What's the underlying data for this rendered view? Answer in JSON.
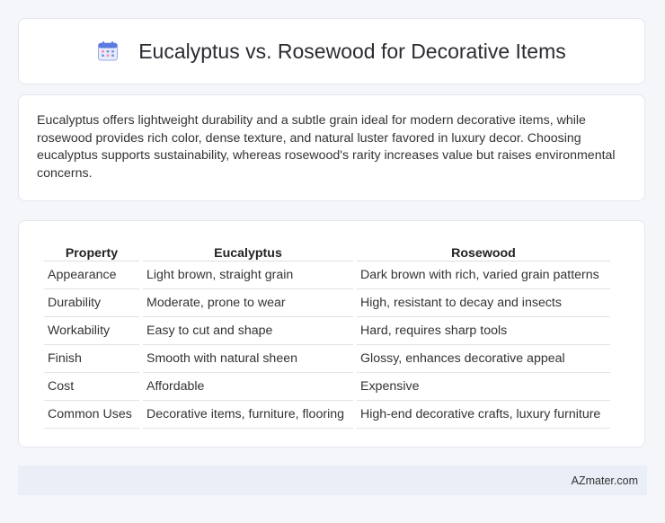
{
  "header": {
    "title": "Eucalyptus vs. Rosewood for Decorative Items",
    "icon": "calendar-icon"
  },
  "summary": {
    "text": "Eucalyptus offers lightweight durability and a subtle grain ideal for modern decorative items, while rosewood provides rich color, dense texture, and natural luster favored in luxury decor. Choosing eucalyptus supports sustainability, whereas rosewood's rarity increases value but raises environmental concerns."
  },
  "table": {
    "headers": [
      "Property",
      "Eucalyptus",
      "Rosewood"
    ],
    "rows": [
      [
        "Appearance",
        "Light brown, straight grain",
        "Dark brown with rich, varied grain patterns"
      ],
      [
        "Durability",
        "Moderate, prone to wear",
        "High, resistant to decay and insects"
      ],
      [
        "Workability",
        "Easy to cut and shape",
        "Hard, requires sharp tools"
      ],
      [
        "Finish",
        "Smooth with natural sheen",
        "Glossy, enhances decorative appeal"
      ],
      [
        "Cost",
        "Affordable",
        "Expensive"
      ],
      [
        "Common Uses",
        "Decorative items, furniture, flooring",
        "High-end decorative crafts, luxury furniture"
      ]
    ]
  },
  "footer": {
    "site": "AZmater.com"
  },
  "colors": {
    "page_background": "#f5f6fa",
    "card_background": "#ffffff",
    "footer_background": "#e9eef7",
    "icon_blue": "#5b7be0",
    "icon_pink": "#f08fb0"
  }
}
